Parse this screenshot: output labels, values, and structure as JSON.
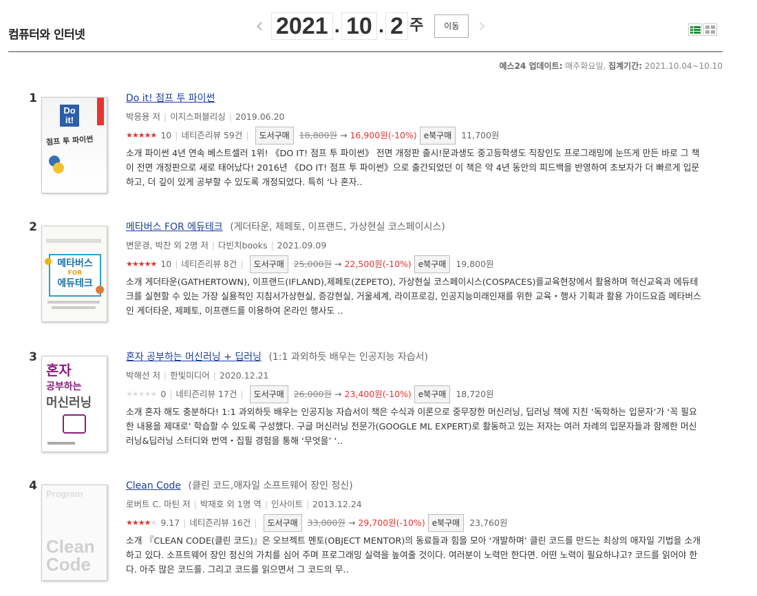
{
  "header": {
    "category": "컴퓨터와 인터넷",
    "year": "2021",
    "month": "10",
    "week": "2",
    "week_suffix": "주",
    "move_label": "이동"
  },
  "update": {
    "label": "예스24 업데이트:",
    "value": "매주화요일,",
    "period_label": "집계기간:",
    "period": "2021.10.04~10.10"
  },
  "books": [
    {
      "rank": "1",
      "title": "Do it! 점프 투 파이썬",
      "subtitle": "",
      "author": "박응용 저",
      "translator": "",
      "publisher": "이지스퍼블리싱",
      "date": "2019.06.20",
      "star_count": 5,
      "score": "10",
      "reviews": "네티즌리뷰 59건",
      "buy_label": "도서구매",
      "price_old": "18,800원",
      "price_new": "16,900원(-10%)",
      "ebook_label": "e북구매",
      "ebook_price": "11,700원",
      "desc": "소개 파이썬 4년 연속 베스트셀러 1위! 《DO IT! 점프 투 파이썬》 전면 개정판 출시!문과생도 중고등학생도 직장인도 프로그래밍에 눈뜨게 만든 바로 그 책이 전면 개정판으로 새로 태어났다! 2016년 《DO IT! 점프 투 파이썬》으로 출간되었던 이 책은 약 4년 동안의 피드백을 반영하여 초보자가 더 빠르게 입문하고, 더 깊이 있게 공부할 수 있도록 개정되었다. 특히 ‘나 혼자..",
      "cover": {
        "line1": "Do",
        "line2": "it!",
        "line3": "점프 투 파이썬"
      }
    },
    {
      "rank": "2",
      "title": "메타버스 FOR 에듀테크",
      "subtitle": "(게더타운, 제페토, 이프랜드, 가상현실 코스페이시스)",
      "author": "변문경, 박찬 외 2명 저",
      "translator": "",
      "publisher": "다빈치books",
      "date": "2021.09.09",
      "star_count": 5,
      "score": "10",
      "reviews": "네티즌리뷰 8건",
      "buy_label": "도서구매",
      "price_old": "25,000원",
      "price_new": "22,500원(-10%)",
      "ebook_label": "e북구매",
      "ebook_price": "19,800원",
      "desc": "소개 게더타운(GATHERTOWN), 이프랜드(IFLAND),제페토(ZEPETO), 가상현실 코스페이시스(COSPACES)를교육현장에서 활용하며 혁신교육과 에듀테크를 실현할 수 있는 가장 실용적인 지침서가상현실, 증강현실, 거울세계, 라이프로깅, 인공지능미래인재를 위한 교육・행사 기획과 활용 가이드요즘 메타버스인 게더타운, 제페토, 이프랜드를 이용하여 온라인 행사도 ..",
      "cover": {
        "line1": "메타버스",
        "line2": "FOR",
        "line3": "에듀테크"
      }
    },
    {
      "rank": "3",
      "title": "혼자 공부하는 머신러닝 + 딥러닝",
      "subtitle": "(1:1 과외하듯 배우는 인공지능 자습서)",
      "author": "박해선 저",
      "translator": "",
      "publisher": "한빛미디어",
      "date": "2020.12.21",
      "star_count": 0,
      "score": "0",
      "reviews": "네티즌리뷰 17건",
      "buy_label": "도서구매",
      "price_old": "26,000원",
      "price_new": "23,400원(-10%)",
      "ebook_label": "e북구매",
      "ebook_price": "18,720원",
      "desc": "소개 혼자 해도 충분하다! 1:1 과외하듯 배우는 인공지능 자습서이 책은 수식과 이론으로 중무장한 머신러닝, 딥러닝 책에 지친 ‘독학하는 입문자’가 ‘꼭 필요한 내용을 제대로’ 학습할 수 있도록 구성했다. 구글 머신러닝 전문가(GOOGLE ML EXPERT)로 활동하고 있는 저자는 여러 차례의 입문자들과 함께한 머신러닝&딥러닝 스터디와 번역・집필 경험을 통해 ‘무엇을’ ‘..",
      "cover": {
        "line1": "혼자",
        "line2": "공부하는",
        "line3": "머신러닝"
      }
    },
    {
      "rank": "4",
      "title": "Clean Code",
      "subtitle": "(클린 코드,애자일 소프트웨어 장인 정신)",
      "author": "로버트 C. 마틴 저",
      "translator": "박재호 외 1명 역",
      "publisher": "인사이트",
      "date": "2013.12.24",
      "star_count": 4.5,
      "score": "9.17",
      "reviews": "네티즌리뷰 16건",
      "buy_label": "도서구매",
      "price_old": "33,000원",
      "price_new": "29,700원(-10%)",
      "ebook_label": "e북구매",
      "ebook_price": "23,760원",
      "desc": "소개 『CLEAN CODE(클린 코드)』은 오브젝트 멘토(OBJECT MENTOR)의 동료들과 힘을 모아 ‘개발하며’ 클린 코드를 만드는 최상의 애자일 기법을 소개하고 있다. 소프트웨어 장인 정신의 가치를 심어 주며 프로그래밍 실력을 높여줄 것이다. 여러분이 노력만 한다면. 어떤 노력이 필요하냐고? 코드를 읽어야 한다. 아주 많은 코드를. 그리고 코드를 읽으면서 그 코드의 무..",
      "cover": {
        "line1": "Program",
        "line2": "Clean",
        "line3": "Code"
      }
    }
  ],
  "colors": {
    "accent": "#e8332f",
    "link": "#1a3e9c"
  }
}
